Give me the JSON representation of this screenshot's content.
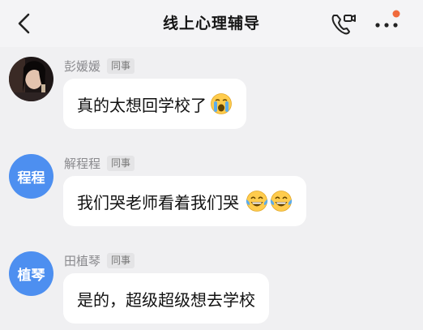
{
  "header": {
    "title": "线上心理辅导"
  },
  "messages": [
    {
      "sender": "彭媛媛",
      "badge": "同事",
      "text": "真的太想回学校了"
    },
    {
      "sender": "解程程",
      "avatar_text": "程程",
      "badge": "同事",
      "text": "我们哭老师看着我们哭"
    },
    {
      "sender": "田植琴",
      "avatar_text": "植琴",
      "badge": "同事",
      "text": "是的，超级超级想去学校"
    }
  ],
  "colors": {
    "avatar_blue": "#4d8ff0",
    "notification_dot": "#f06a3c",
    "background": "#f0f0f2"
  },
  "icons": [
    "back-arrow-icon",
    "video-call-icon",
    "more-dots-icon",
    "crying-face-emoji",
    "laughing-tears-emoji"
  ]
}
